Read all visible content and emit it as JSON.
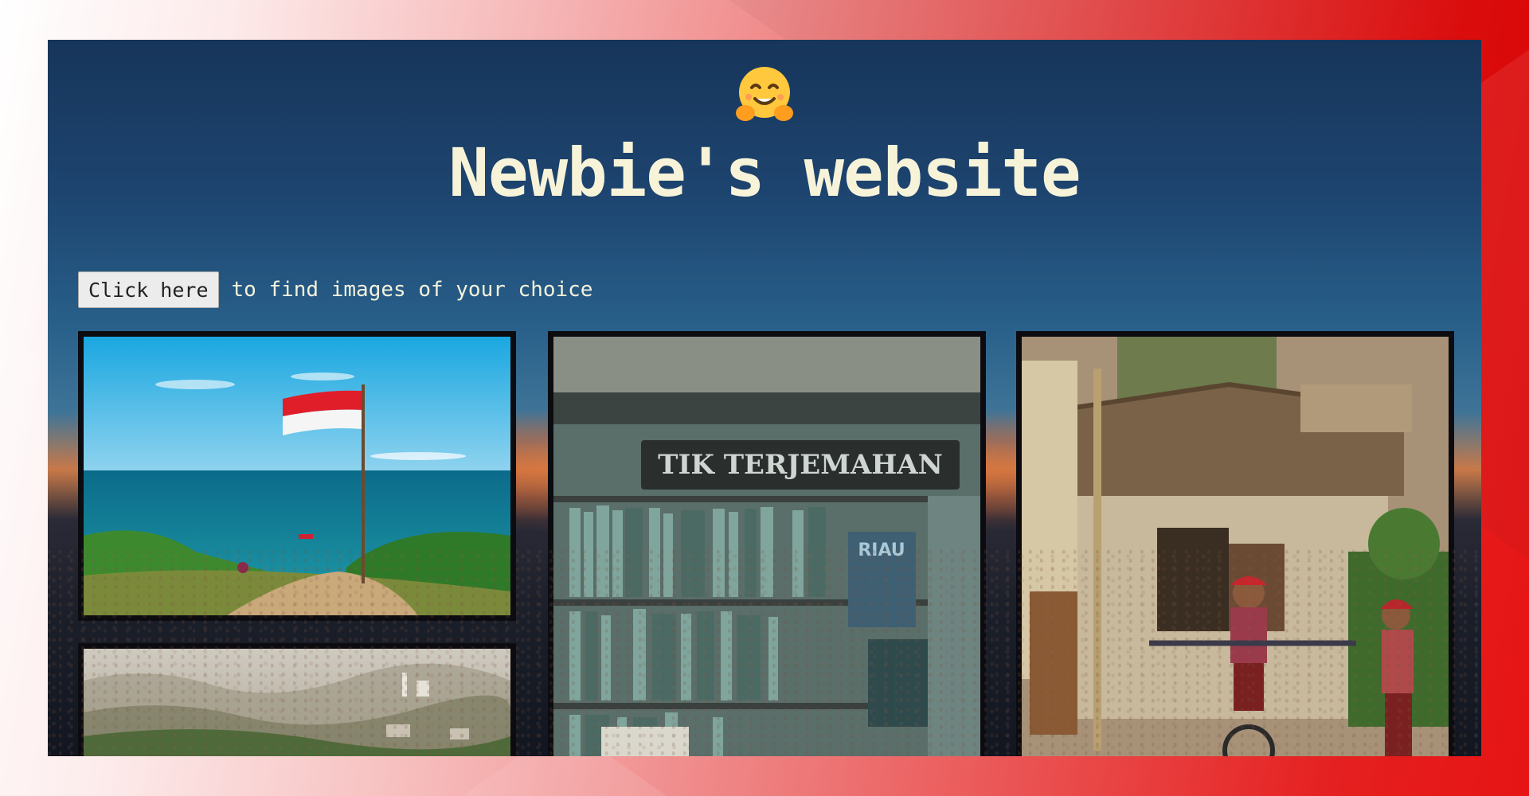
{
  "header": {
    "emoji_icon": "hugging-face-emoji",
    "title": "Newbie's website"
  },
  "intro": {
    "button_label": "Click here",
    "text": "to find images of your choice"
  },
  "gallery": {
    "images": [
      {
        "subject": "flag-on-cliff-by-sea"
      },
      {
        "subject": "bookshop-shelves",
        "sign_text": "TIK TERJEMAHAN",
        "book_text": "RIAU"
      },
      {
        "subject": "boy-on-bicycle-by-hut"
      },
      {
        "subject": "misty-city-aerial-view"
      }
    ]
  },
  "colors": {
    "title": "#f7f3d9",
    "frame_red": "#e40000",
    "card_border": "#0c0c10"
  }
}
